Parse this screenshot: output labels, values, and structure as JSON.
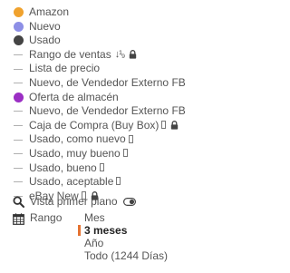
{
  "legend": {
    "items": [
      {
        "label": "Amazon",
        "marker": "dot",
        "color": "#f0a22e"
      },
      {
        "label": "Nuevo",
        "marker": "dot",
        "color": "#8d8fe6"
      },
      {
        "label": "Usado",
        "marker": "dot",
        "color": "#444444"
      },
      {
        "label": "Rango de ventas",
        "marker": "line",
        "color": "#b0b0b0",
        "sort_icon": "↓¹₉",
        "lock": true
      },
      {
        "label": "Lista de precio",
        "marker": "line",
        "color": "#b0b0b0"
      },
      {
        "label": "Nuevo, de Vendedor Externo FB",
        "marker": "line",
        "color": "#b0b0b0"
      },
      {
        "label": "Oferta de almacén",
        "marker": "dot",
        "color": "#9b2fc4"
      },
      {
        "label": "Nuevo, de Vendedor Externo FB",
        "marker": "line",
        "color": "#b0b0b0"
      },
      {
        "label": "Caja de Compra (Buy Box)",
        "marker": "line",
        "color": "#b0b0b0",
        "box": true,
        "lock": true
      },
      {
        "label": "Usado, como nuevo",
        "marker": "line",
        "color": "#b0b0b0",
        "box": true
      },
      {
        "label": "Usado, muy bueno",
        "marker": "line",
        "color": "#b0b0b0",
        "box": true
      },
      {
        "label": "Usado, bueno",
        "marker": "line",
        "color": "#b0b0b0",
        "box": true
      },
      {
        "label": "Usado, aceptable",
        "marker": "line",
        "color": "#b0b0b0",
        "box": true
      },
      {
        "label": "eBay New",
        "marker": "line",
        "color": "#b0b0b0",
        "box": true,
        "lock": true
      }
    ]
  },
  "controls": {
    "vista_label": "Vista primer plano",
    "rango_label": "Rango",
    "range_options": [
      "Mes",
      "3 meses",
      "Año",
      "Todo (1244 Días)"
    ],
    "selected_range": "3 meses",
    "accent_color": "#e57332"
  }
}
